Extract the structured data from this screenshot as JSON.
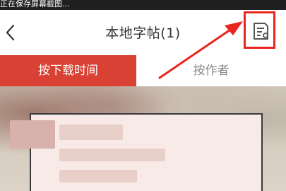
{
  "status_bar": {
    "text": "正在保存屏幕截图..."
  },
  "header": {
    "title": "本地字帖(1)"
  },
  "tabs": [
    {
      "label": "按下载时间",
      "active": true
    },
    {
      "label": "按作者",
      "active": false
    }
  ],
  "colors": {
    "accent": "#d94134",
    "highlight": "#e8251f"
  },
  "icons": {
    "back": "chevron-left",
    "sort_menu": "list-settings"
  }
}
